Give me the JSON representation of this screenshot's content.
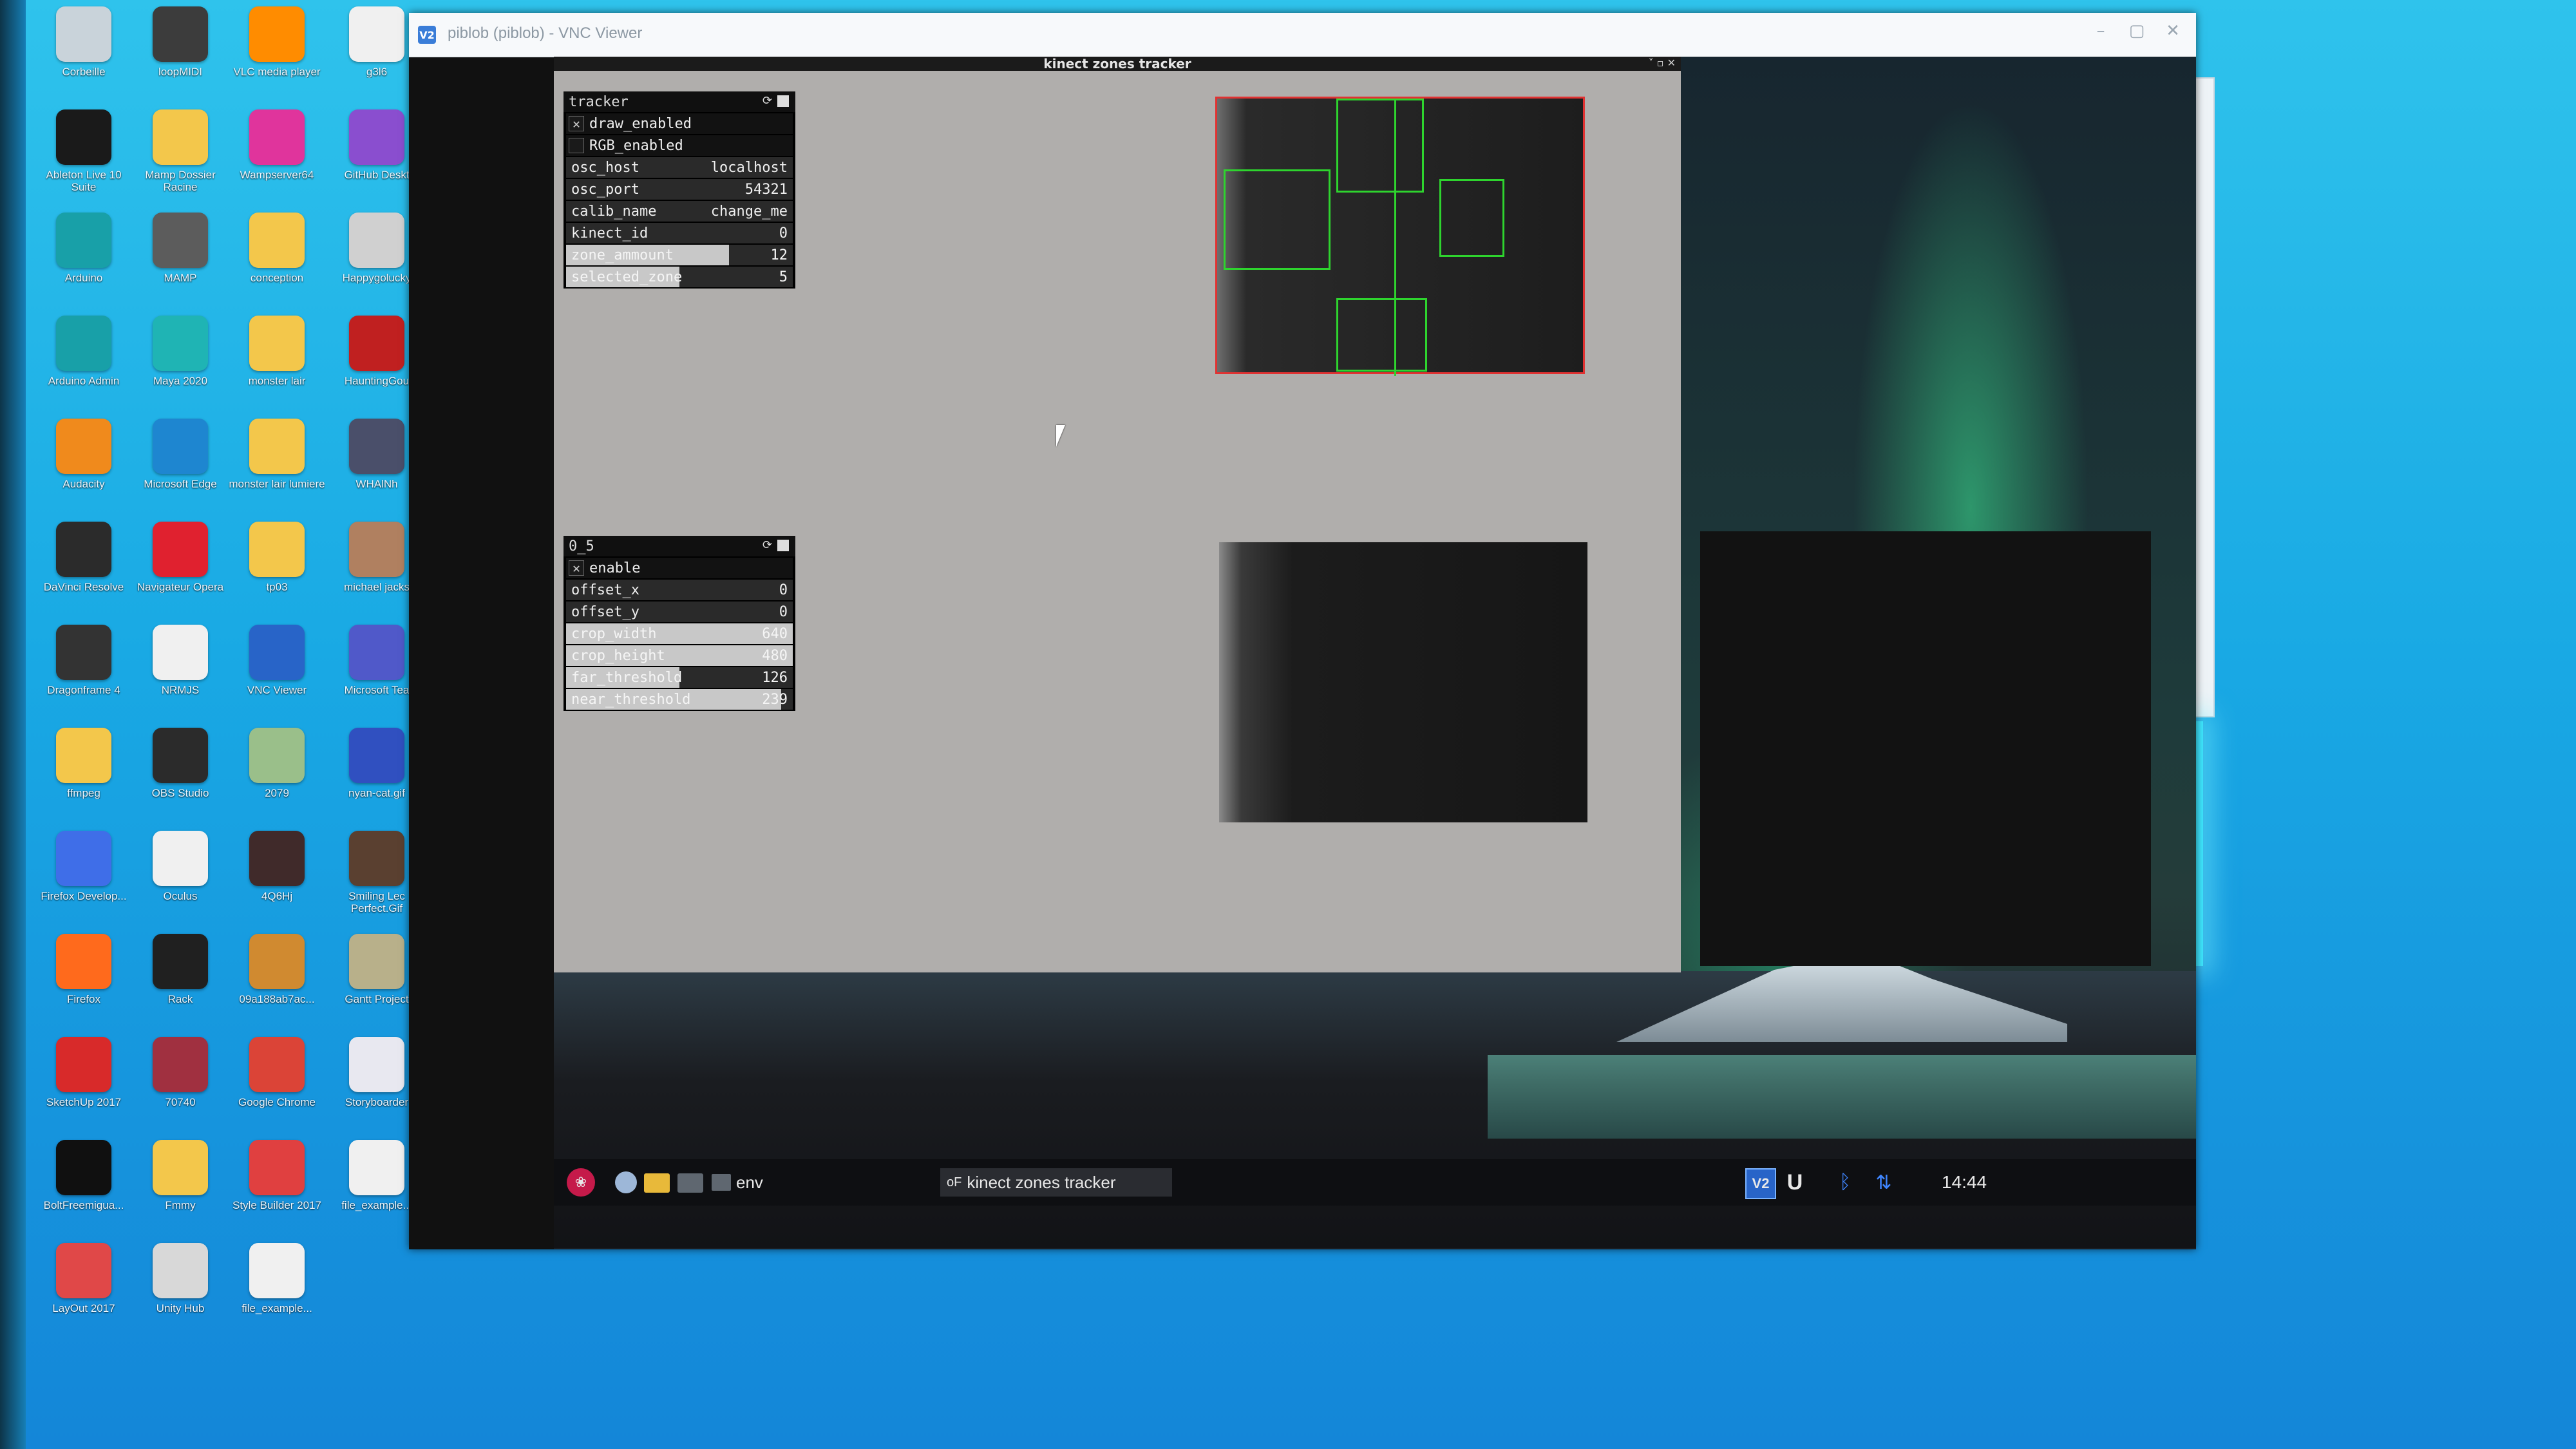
{
  "desktop": {
    "icons": [
      {
        "label": "Corbeille",
        "color": "#c9d3da"
      },
      {
        "label": "loopMIDI",
        "color": "#3c3c3c"
      },
      {
        "label": "VLC media player",
        "color": "#ff8c00"
      },
      {
        "label": "g3l6",
        "color": "#f0f0f0"
      },
      {
        "label": "Ableton Live 10 Suite",
        "color": "#1a1a1a"
      },
      {
        "label": "Mamp Dossier Racine",
        "color": "#f3c74b"
      },
      {
        "label": "Wampserver64",
        "color": "#e0349c"
      },
      {
        "label": "GitHub Deskt",
        "color": "#8a4ecf"
      },
      {
        "label": "Arduino",
        "color": "#18a0a8"
      },
      {
        "label": "MAMP",
        "color": "#5c5c5c"
      },
      {
        "label": "conception",
        "color": "#f3c74b"
      },
      {
        "label": "Happygolucky",
        "color": "#d0d0d0"
      },
      {
        "label": "Arduino Admin",
        "color": "#18a0a8"
      },
      {
        "label": "Maya 2020",
        "color": "#1fb4b4"
      },
      {
        "label": "monster lair",
        "color": "#f3c74b"
      },
      {
        "label": "HauntingGou",
        "color": "#c02020"
      },
      {
        "label": "Audacity",
        "color": "#f08a1c"
      },
      {
        "label": "Microsoft Edge",
        "color": "#1e86d0"
      },
      {
        "label": "monster lair lumiere",
        "color": "#f3c74b"
      },
      {
        "label": "WHAlNh",
        "color": "#4a4f6a"
      },
      {
        "label": "DaVinci Resolve",
        "color": "#2b2b2b"
      },
      {
        "label": "Navigateur Opera",
        "color": "#e0212f"
      },
      {
        "label": "tp03",
        "color": "#f3c74b"
      },
      {
        "label": "michael jacks",
        "color": "#b08060"
      },
      {
        "label": "Dragonframe 4",
        "color": "#333333"
      },
      {
        "label": "NRMJS",
        "color": "#f0f0f0"
      },
      {
        "label": "VNC Viewer",
        "color": "#2864c8"
      },
      {
        "label": "Microsoft Tea",
        "color": "#5059c9"
      },
      {
        "label": "ffmpeg",
        "color": "#f3c74b"
      },
      {
        "label": "OBS Studio",
        "color": "#2b2b2b"
      },
      {
        "label": "2079",
        "color": "#9abf8a"
      },
      {
        "label": "nyan-cat.gif",
        "color": "#3050c0"
      },
      {
        "label": "Firefox Develop...",
        "color": "#3f6ee8"
      },
      {
        "label": "Oculus",
        "color": "#f0f0f0"
      },
      {
        "label": "4Q6Hj",
        "color": "#402a2a"
      },
      {
        "label": "Smiling Lec Perfect.Gif",
        "color": "#5a4030"
      },
      {
        "label": "Firefox",
        "color": "#ff6a1c"
      },
      {
        "label": "Rack",
        "color": "#202020"
      },
      {
        "label": "09a188ab7ac...",
        "color": "#d08a30"
      },
      {
        "label": "Gantt Project",
        "color": "#b8b08a"
      },
      {
        "label": "SketchUp 2017",
        "color": "#d82a2a"
      },
      {
        "label": "70740",
        "color": "#a03040"
      },
      {
        "label": "Google Chrome",
        "color": "#db4437"
      },
      {
        "label": "Storyboarder",
        "color": "#e8e8f0"
      },
      {
        "label": "BoltFreemigua...",
        "color": "#101010"
      },
      {
        "label": "Fmmy",
        "color": "#f3c74b"
      },
      {
        "label": "Style Builder 2017",
        "color": "#e04040"
      },
      {
        "label": "file_example...",
        "color": "#f0f0f0"
      },
      {
        "label": "LayOut 2017",
        "color": "#e04848"
      },
      {
        "label": "Unity Hub",
        "color": "#d8d8d8"
      },
      {
        "label": "file_example...",
        "color": "#f0f0f0"
      }
    ]
  },
  "vnc": {
    "window_title": "piblob (piblob) - VNC Viewer",
    "app_icon": "V2",
    "controls": {
      "minimize": "–",
      "maximize": "▢",
      "close": "✕"
    }
  },
  "app": {
    "title": "kinect zones tracker",
    "title_buttons": "˅ ▫ ✕"
  },
  "tracker_panel": {
    "title": "tracker",
    "rows": [
      {
        "type": "toggle",
        "label": "draw_enabled",
        "checked": true
      },
      {
        "type": "toggle",
        "label": "RGB_enabled",
        "checked": false
      },
      {
        "type": "value",
        "label": "osc_host",
        "value": "localhost"
      },
      {
        "type": "value",
        "label": "osc_port",
        "value": "54321"
      },
      {
        "type": "value",
        "label": "calib_name",
        "value": "change_me"
      },
      {
        "type": "value",
        "label": "kinect_id",
        "value": "0"
      },
      {
        "type": "slider",
        "label": "zone_ammount",
        "value": "12",
        "fill": 0.72
      },
      {
        "type": "slider",
        "label": "selected_zone",
        "value": "5",
        "fill": 0.5
      }
    ]
  },
  "zone_panel": {
    "title": "0_5",
    "rows": [
      {
        "type": "toggle",
        "label": "enable",
        "checked": true
      },
      {
        "type": "value",
        "label": "offset_x",
        "value": "0"
      },
      {
        "type": "value",
        "label": "offset_y",
        "value": "0"
      },
      {
        "type": "slider",
        "label": "crop_width",
        "value": "640",
        "fill": 1.0
      },
      {
        "type": "slider",
        "label": "crop_height",
        "value": "480",
        "fill": 1.0
      },
      {
        "type": "slider",
        "label": "far_threshold",
        "value": "126",
        "fill": 0.5
      },
      {
        "type": "slider",
        "label": "near_threshold",
        "value": "239",
        "fill": 0.95
      }
    ]
  },
  "remote_taskbar": {
    "launcher_label": "env",
    "active_app": "kinect zones tracker",
    "vnc_tray": "V2",
    "u_tray": "U",
    "bluetooth": "ᛒ",
    "network": "⇅",
    "clock": "14:44"
  }
}
